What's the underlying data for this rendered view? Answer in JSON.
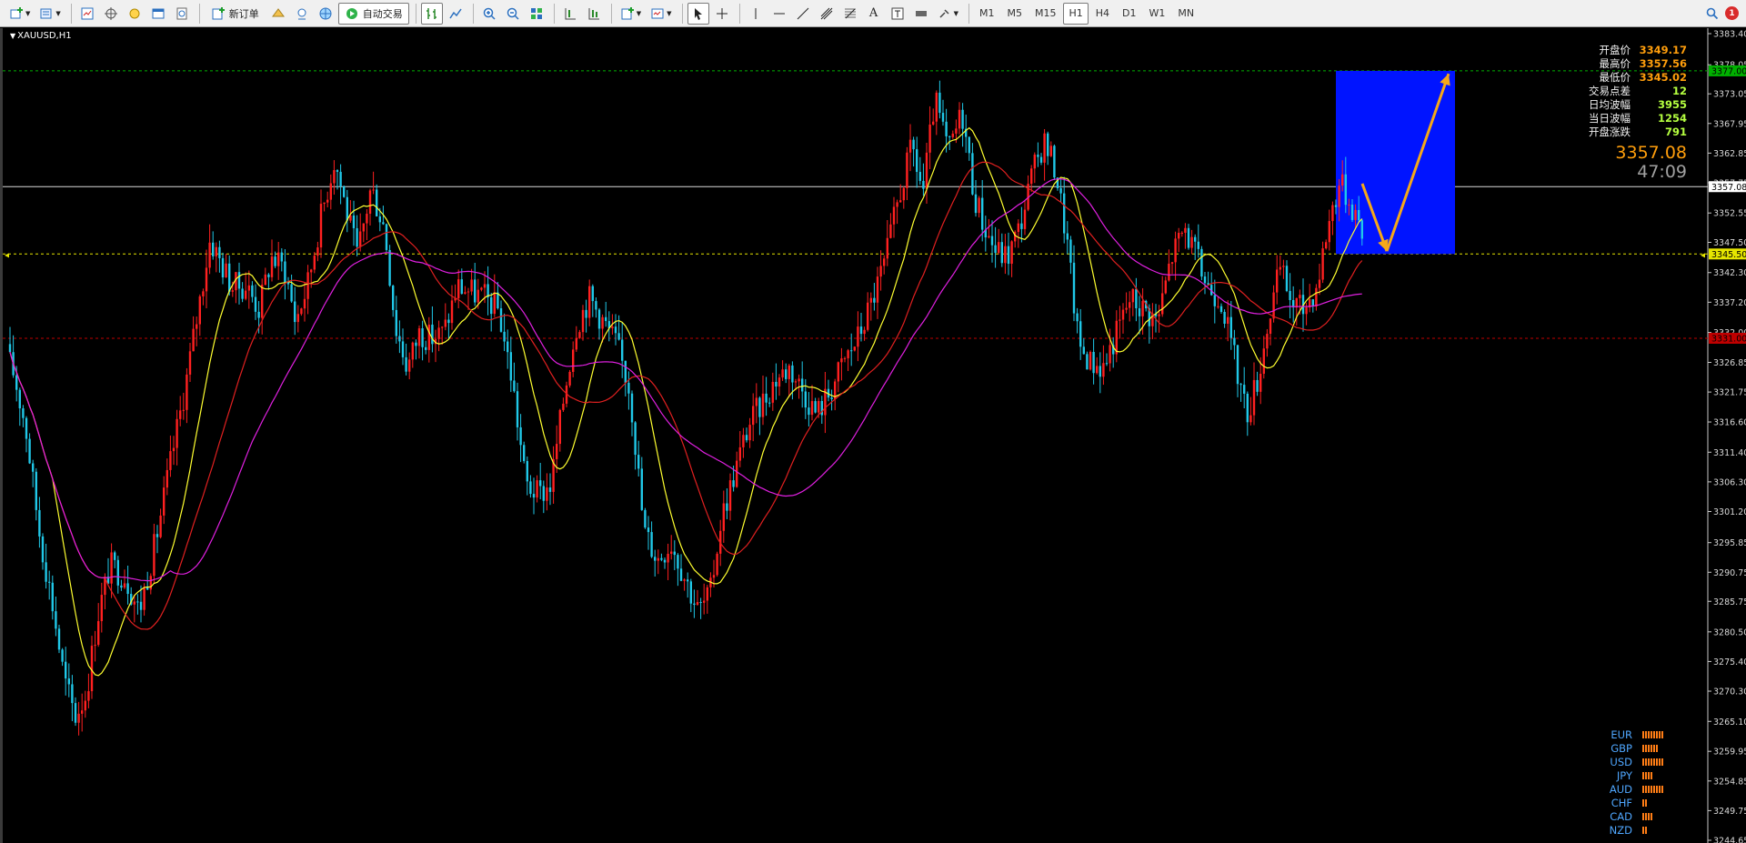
{
  "toolbar": {
    "new_order_label": "新订单",
    "autotrade_label": "自动交易",
    "timeframes": [
      "M1",
      "M5",
      "M15",
      "H1",
      "H4",
      "D1",
      "W1",
      "MN"
    ],
    "active_timeframe": "H1",
    "notification_count": "1"
  },
  "chart": {
    "symbol_label": "XAUUSD,H1"
  },
  "info": {
    "rows": [
      {
        "label": "开盘价",
        "value": "3349.17",
        "color": "#ff9e0c"
      },
      {
        "label": "最高价",
        "value": "3357.56",
        "color": "#ff9e0c"
      },
      {
        "label": "最低价",
        "value": "3345.02",
        "color": "#ff9e0c"
      },
      {
        "label": "交易点差",
        "value": "12",
        "color": "#b5ff40"
      },
      {
        "label": "日均波幅",
        "value": "3955",
        "color": "#b5ff40"
      },
      {
        "label": "当日波幅",
        "value": "1254",
        "color": "#b5ff40"
      },
      {
        "label": "开盘涨跌",
        "value": "791",
        "color": "#b5ff40"
      }
    ],
    "current_price": "3357.08",
    "countdown": "47:09"
  },
  "price_axis": {
    "ticks": [
      "3383.40",
      "3378.05",
      "3373.05",
      "3367.95",
      "3362.85",
      "3357.75",
      "3352.55",
      "3347.50",
      "3342.30",
      "3337.20",
      "3332.00",
      "3326.85",
      "3321.75",
      "3316.60",
      "3311.40",
      "3306.30",
      "3301.20",
      "3295.85",
      "3290.75",
      "3285.75",
      "3280.50",
      "3275.40",
      "3270.30",
      "3265.10",
      "3259.95",
      "3254.85",
      "3249.75",
      "3244.65"
    ],
    "markers": [
      {
        "label": "3377.00",
        "color": "#00b000",
        "text_color": "#000000"
      },
      {
        "label": "3357.08",
        "color": "#ffffff",
        "text_color": "#000000"
      },
      {
        "label": "3345.50",
        "color": "#e6e600",
        "text_color": "#000000"
      },
      {
        "label": "3331.00",
        "color": "#c00000",
        "text_color": "#000000"
      }
    ]
  },
  "colors": {
    "bull_candle": "#ff2020",
    "bear_candle": "#20c8e8",
    "ma_fast": "#ffff30",
    "ma_mid": "#e02020",
    "ma_slow": "#e020e0",
    "target_box": "#0014ff",
    "arrow": "#f5a818"
  },
  "currency_strength": [
    {
      "name": "EUR",
      "level": 8
    },
    {
      "name": "GBP",
      "level": 6
    },
    {
      "name": "USD",
      "level": 8
    },
    {
      "name": "JPY",
      "level": 4
    },
    {
      "name": "AUD",
      "level": 8
    },
    {
      "name": "CHF",
      "level": 2
    },
    {
      "name": "CAD",
      "level": 4
    },
    {
      "name": "NZD",
      "level": 2
    }
  ]
}
